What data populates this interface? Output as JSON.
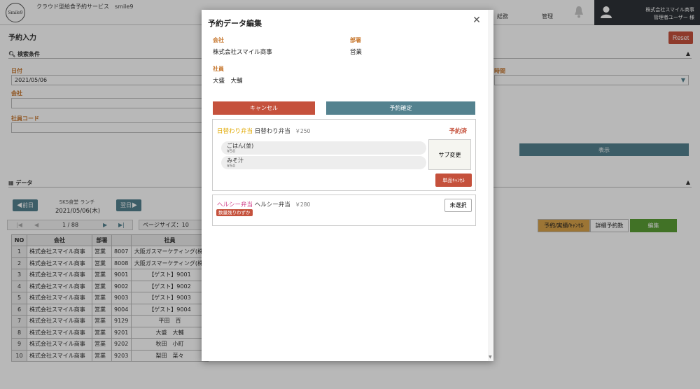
{
  "header": {
    "logo_text": "Smile9",
    "app_title": "クラウド型給食予約サービス　smile9",
    "nav": [
      "総務",
      "管理"
    ],
    "user_company": "株式会社スマイル商事",
    "user_name": "管理者ユーザー 様"
  },
  "page": {
    "title": "予約入力",
    "reset_label": "Reset",
    "search_section": "検索条件",
    "date_label": "日付",
    "date_value": "2021/05/06",
    "company_label": "会社",
    "employee_code_label": "社員コード",
    "time_label": "時間",
    "display_button": "表示",
    "data_section": "データ",
    "prev_button": "◀前日",
    "next_button": "翌日▶",
    "cafeteria": "SKS食堂 ランチ",
    "current_date": "2021/05/06(木)",
    "pager": {
      "first": "|◀",
      "prev": "◀",
      "page": "1 / 88",
      "next": "▶",
      "last": "▶|"
    },
    "page_size": "ページサイズ：10",
    "tabs": [
      "予約/実績/ｷｬﾝｾﾙ",
      "詳細予約数",
      "編集"
    ]
  },
  "table": {
    "headers": [
      "NO",
      "会社",
      "部署",
      "",
      "社員"
    ],
    "rows": [
      [
        "1",
        "株式会社スマイル商事",
        "営業",
        "8007",
        "大阪ガスマーケティング(株)"
      ],
      [
        "2",
        "株式会社スマイル商事",
        "営業",
        "8008",
        "大阪ガスマーケティング(株)"
      ],
      [
        "3",
        "株式会社スマイル商事",
        "営業",
        "9001",
        "【ゲスト】9001"
      ],
      [
        "4",
        "株式会社スマイル商事",
        "営業",
        "9002",
        "【ゲスト】9002"
      ],
      [
        "5",
        "株式会社スマイル商事",
        "営業",
        "9003",
        "【ゲスト】9003"
      ],
      [
        "6",
        "株式会社スマイル商事",
        "営業",
        "9004",
        "【ゲスト】9004"
      ],
      [
        "7",
        "株式会社スマイル商事",
        "営業",
        "9129",
        "平田　百"
      ],
      [
        "8",
        "株式会社スマイル商事",
        "営業",
        "9201",
        "大盛　大輔"
      ],
      [
        "9",
        "株式会社スマイル商事",
        "営業",
        "9202",
        "秋田　小町"
      ],
      [
        "10",
        "株式会社スマイル商事",
        "営業",
        "9203",
        "梨田　菜々"
      ]
    ]
  },
  "modal": {
    "title": "予約データ編集",
    "company_label": "会社",
    "company_value": "株式会社スマイル商事",
    "dept_label": "部署",
    "dept_value": "営業",
    "employee_label": "社員",
    "employee_value": "大盛　大輔",
    "cancel_button": "キャンセル",
    "confirm_button": "予約確定",
    "menus": [
      {
        "category": "日替わり弁当",
        "name": "日替わり弁当",
        "price": "￥250",
        "status": "予約済",
        "items": [
          {
            "name": "ごはん(並)",
            "price": "¥50"
          },
          {
            "name": "みそ汁",
            "price": "¥50"
          }
        ],
        "sub_button": "サブ変更",
        "single_cancel": "単品ｷｬﾝｾﾙ"
      },
      {
        "category": "ヘルシー弁当",
        "name": "ヘルシー弁当",
        "price": "￥280",
        "badge": "数量残りわずか",
        "select_button": "未選択"
      }
    ]
  },
  "colors": {
    "accent_red": "#c5513c",
    "accent_teal": "#54828f",
    "label_orange": "#c7772e",
    "category_yellow": "#e0a800",
    "category_pink": "#d0408a",
    "edit_green": "#5a9e35",
    "tab_orange": "#d9a24a"
  }
}
